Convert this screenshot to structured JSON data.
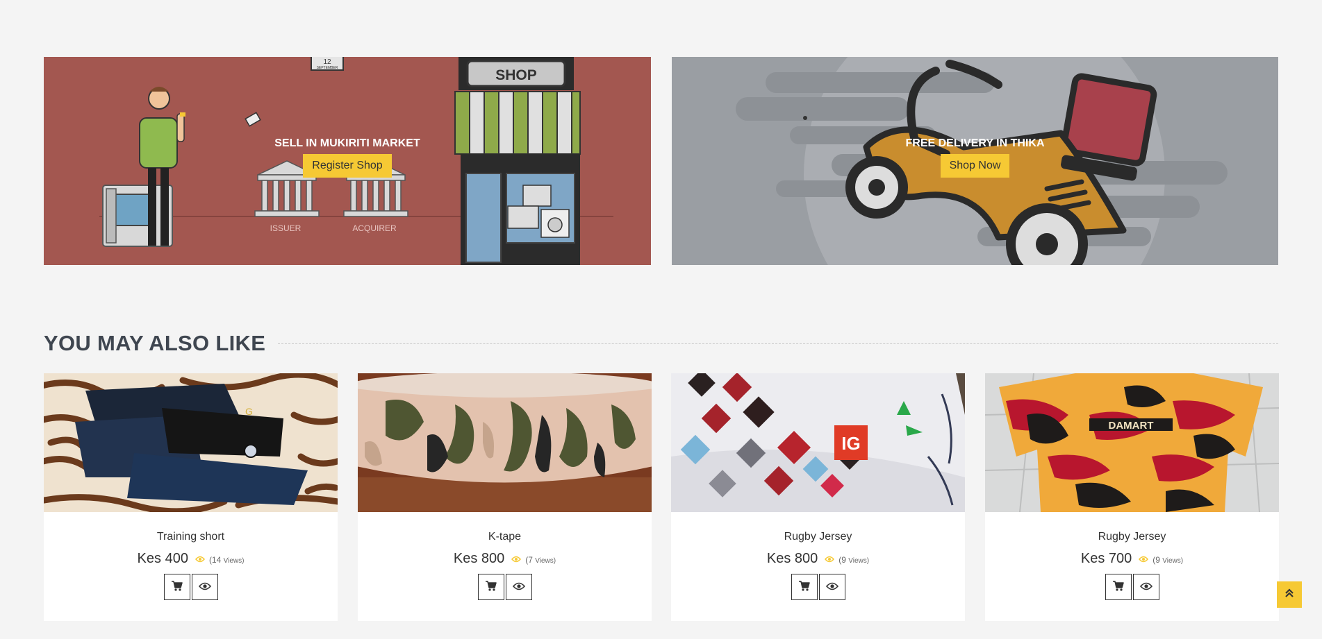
{
  "banners": [
    {
      "title": "SELL IN MUKIRITI MARKET",
      "button": "Register Shop",
      "labels": {
        "issuer": "ISSUER",
        "acquirer": "ACQUIRER",
        "shop": "SHOP",
        "calendar_day": "12",
        "calendar_month": "SEPTEMBER"
      }
    },
    {
      "title": "FREE DELIVERY IN THIKA",
      "button": "Shop Now"
    }
  ],
  "section": {
    "title": "YOU MAY ALSO LIKE"
  },
  "products": [
    {
      "name": "Training short",
      "price": "Kes 400",
      "views_count": "(14",
      "views_word": "Views)"
    },
    {
      "name": "K-tape",
      "price": "Kes 800",
      "views_count": "(7",
      "views_word": "Views)"
    },
    {
      "name": "Rugby Jersey",
      "price": "Kes 800",
      "views_count": "(9",
      "views_word": "Views)"
    },
    {
      "name": "Rugby Jersey",
      "price": "Kes 700",
      "views_count": "(9",
      "views_word": "Views)"
    }
  ],
  "icons": {
    "cart": "cart-icon",
    "view": "eye-icon",
    "scroll_top": "double-chevron-up-icon"
  },
  "colors": {
    "accent": "#f6c934",
    "banner_left_bg": "#a35750",
    "banner_right_bg": "#9a9ea3",
    "heading": "#3f4650"
  }
}
